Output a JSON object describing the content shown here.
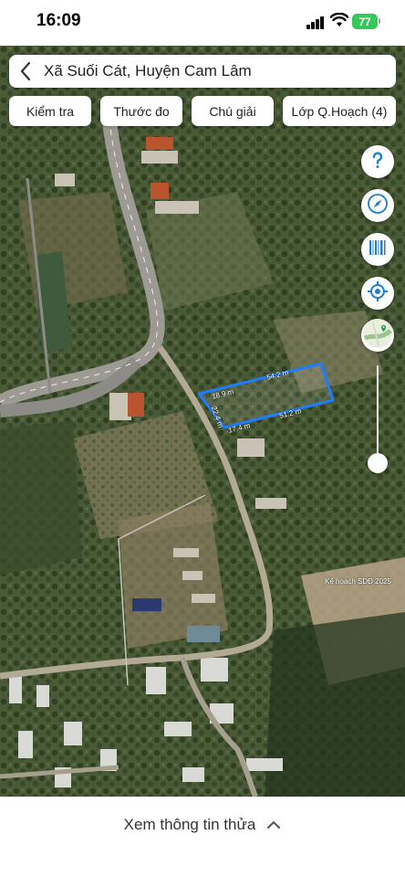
{
  "status": {
    "time": "16:09",
    "battery": "77"
  },
  "header": {
    "back_icon": "chevron-left-icon",
    "title": "Xã Suối Cát, Huyện Cam Lâm"
  },
  "filters": [
    {
      "label": "Kiểm tra"
    },
    {
      "label": "Thước đo"
    },
    {
      "label": "Chú giải"
    },
    {
      "label": "Lớp Q.Hoạch (4)"
    }
  ],
  "controls": {
    "help_icon": "question-icon",
    "compass_icon": "compass-icon",
    "barcode_icon": "barcode-icon",
    "locate_icon": "location-target-icon",
    "map_layer_icon": "map-layer-icon",
    "accent": "#1a7fd4"
  },
  "map": {
    "parcel_color": "#1e7cff",
    "measurements": {
      "top": "54.2 m",
      "left_top": "18.9 m",
      "left": "22.4 m",
      "bottom_left": "17.4 m",
      "bottom_right": "51.2 m"
    },
    "plan_label": "Kế hoạch SDĐ 2025"
  },
  "bottom": {
    "info_label": "Xem thông tin thửa",
    "chevron_icon": "chevron-up-icon"
  }
}
